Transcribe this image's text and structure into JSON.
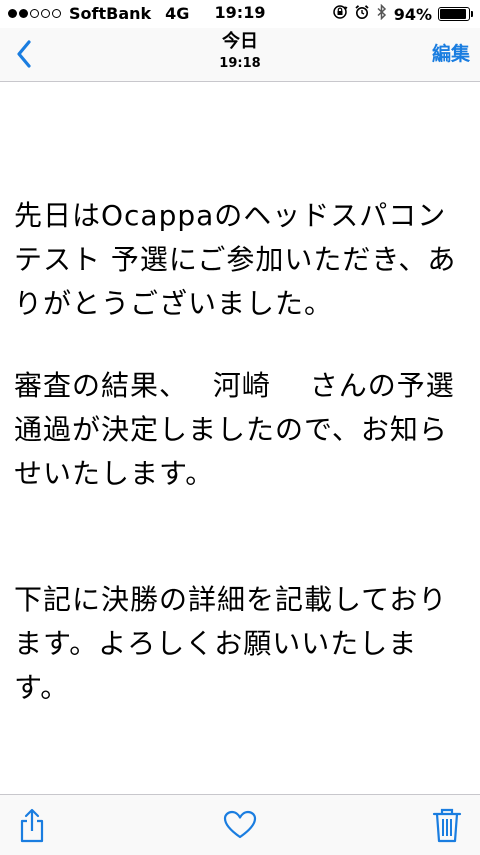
{
  "status_bar": {
    "signal_dots_filled": 2,
    "signal_dots_total": 5,
    "carrier": "SoftBank",
    "network": "4G",
    "time": "19:19",
    "battery_percent": "94%",
    "battery_level": 0.94,
    "icons": [
      "rotation-lock-icon",
      "alarm-clock-icon",
      "bluetooth-icon",
      "battery-icon"
    ]
  },
  "nav": {
    "back_icon": "chevron-left-icon",
    "title": "今日",
    "subtitle": "19:18",
    "edit_label": "編集"
  },
  "message": {
    "paragraphs": [
      "先日はOcappaのヘッドスパコンテスト 予選にご参加いただき、ありがとうございました。",
      "審査の結果、　 河崎　 さんの予選通過が決定しましたので、お知らせいたします。",
      "下記に決勝の詳細を記載しております。よろしくお願いいたします。"
    ]
  },
  "toolbar": {
    "icons": [
      "share-icon",
      "heart-icon",
      "trash-icon"
    ]
  },
  "colors": {
    "accent": "#1a7de0",
    "bar_background": "#f9f9f9",
    "separator": "#c8c7cc",
    "text": "#000000"
  }
}
